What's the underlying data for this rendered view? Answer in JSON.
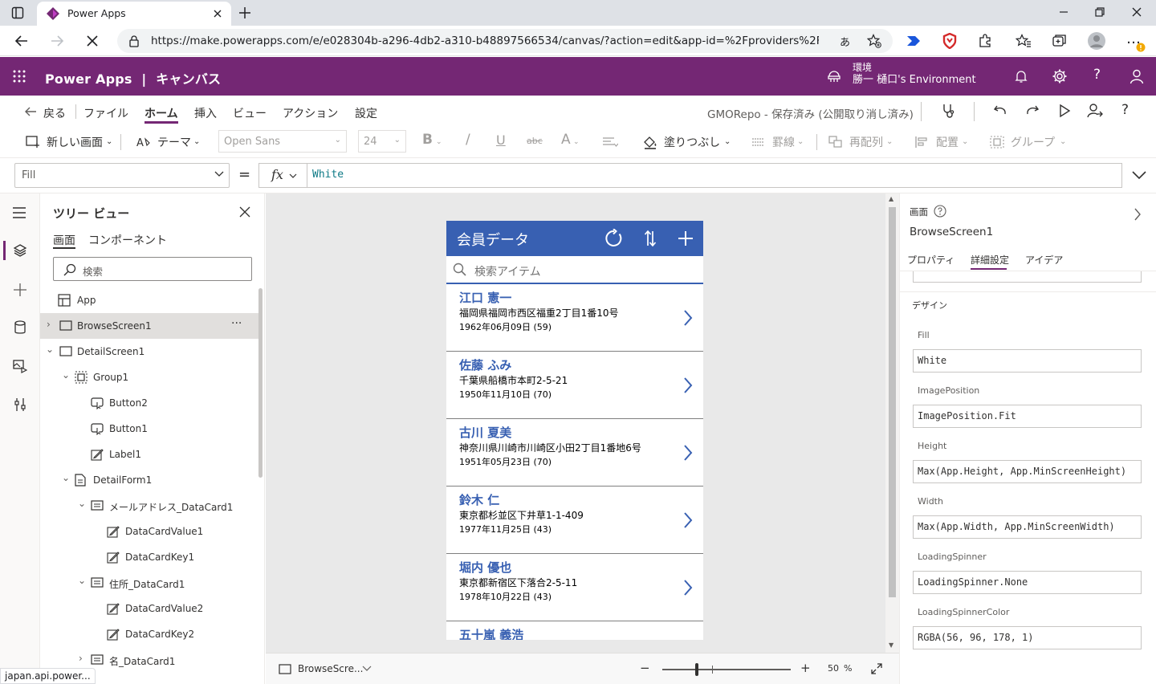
{
  "browser": {
    "tab_title": "Power Apps",
    "url": "https://make.powerapps.com/e/e028304b-a296-4db2-a310-b48897566534/canvas/?action=edit&app-id=%2Fproviders%2FMicrosoft....",
    "status_url": "japan.api.power...",
    "translate_glyph": "あ",
    "more_glyph": "…",
    "colors": {
      "tabbar": "#dee1e6",
      "alert": "#f2a900"
    }
  },
  "header": {
    "app_name": "Power Apps",
    "separator": "|",
    "mode": "キャンバス",
    "env_label": "環境",
    "env_name": "勝一 樋口's Environment",
    "color": "#742774"
  },
  "menu": {
    "back": "戻る",
    "items": [
      "ファイル",
      "ホーム",
      "挿入",
      "ビュー",
      "アクション",
      "設定"
    ],
    "active": "ホーム",
    "save_status": "GMORepo - 保存済み (公開取り消し済み)"
  },
  "toolbar": {
    "new_screen": "新しい画面",
    "theme": "テーマ",
    "font": "Open Sans",
    "font_size": "24",
    "bold": "B",
    "italic": "/",
    "underline": "U",
    "strike": "abc",
    "font_color": "A",
    "fill": "塗りつぶし",
    "border": "罫線",
    "reorder": "再配列",
    "align": "配置",
    "group": "グループ"
  },
  "formula": {
    "property": "Fill",
    "eq": "=",
    "fx": "fx",
    "value": "White"
  },
  "tree": {
    "title": "ツリー ビュー",
    "tabs": [
      "画面",
      "コンポーネント"
    ],
    "active_tab": "画面",
    "search_placeholder": "検索",
    "nodes": [
      "App",
      "BrowseScreen1",
      "DetailScreen1",
      "Group1",
      "Button2",
      "Button1",
      "Label1",
      "DetailForm1",
      "メールアドレス_DataCard1",
      "DataCardValue1",
      "DataCardKey1",
      "住所_DataCard1",
      "DataCardValue2",
      "DataCardKey2",
      "名_DataCard1"
    ],
    "more": "···"
  },
  "app": {
    "title": "会員データ",
    "search_placeholder": "検索アイテム",
    "accent": "#3860b2",
    "records": [
      {
        "name": "江口 憲一",
        "address": "福岡県福岡市西区福重2丁目1番10号",
        "date": "1962年06月09日 (59)"
      },
      {
        "name": "佐藤 ふみ",
        "address": "千葉県船橋市本町2-5-21",
        "date": "1950年11月10日 (70)"
      },
      {
        "name": "古川 夏美",
        "address": "神奈川県川崎市川崎区小田2丁目1番地6号",
        "date": "1951年05月23日 (70)"
      },
      {
        "name": "鈴木 仁",
        "address": "東京都杉並区下井草1-1-409",
        "date": "1977年11月25日 (43)"
      },
      {
        "name": "堀内 優也",
        "address": "東京都新宿区下落合2-5-11",
        "date": "1978年10月22日 (43)"
      },
      {
        "name": "五十嵐 義浩",
        "address": "",
        "date": ""
      }
    ]
  },
  "canvas_footer": {
    "screen": "BrowseScre...",
    "minus": "−",
    "plus": "+",
    "zoom": "50",
    "zoom_unit": "%",
    "zoom_percent": 50
  },
  "props": {
    "kind": "画面",
    "screen_name": "BrowseScreen1",
    "tabs": [
      "プロパティ",
      "詳細設定",
      "アイデア"
    ],
    "active_tab": "詳細設定",
    "section": "デザイン",
    "fields": [
      {
        "label": "Fill",
        "value": "White"
      },
      {
        "label": "ImagePosition",
        "value": "ImagePosition.Fit"
      },
      {
        "label": "Height",
        "value": "Max(App.Height, App.MinScreenHeight)"
      },
      {
        "label": "Width",
        "value": "Max(App.Width, App.MinScreenWidth)"
      },
      {
        "label": "LoadingSpinner",
        "value": "LoadingSpinner.None"
      },
      {
        "label": "LoadingSpinnerColor",
        "value": "RGBA(56, 96, 178, 1)"
      }
    ]
  }
}
